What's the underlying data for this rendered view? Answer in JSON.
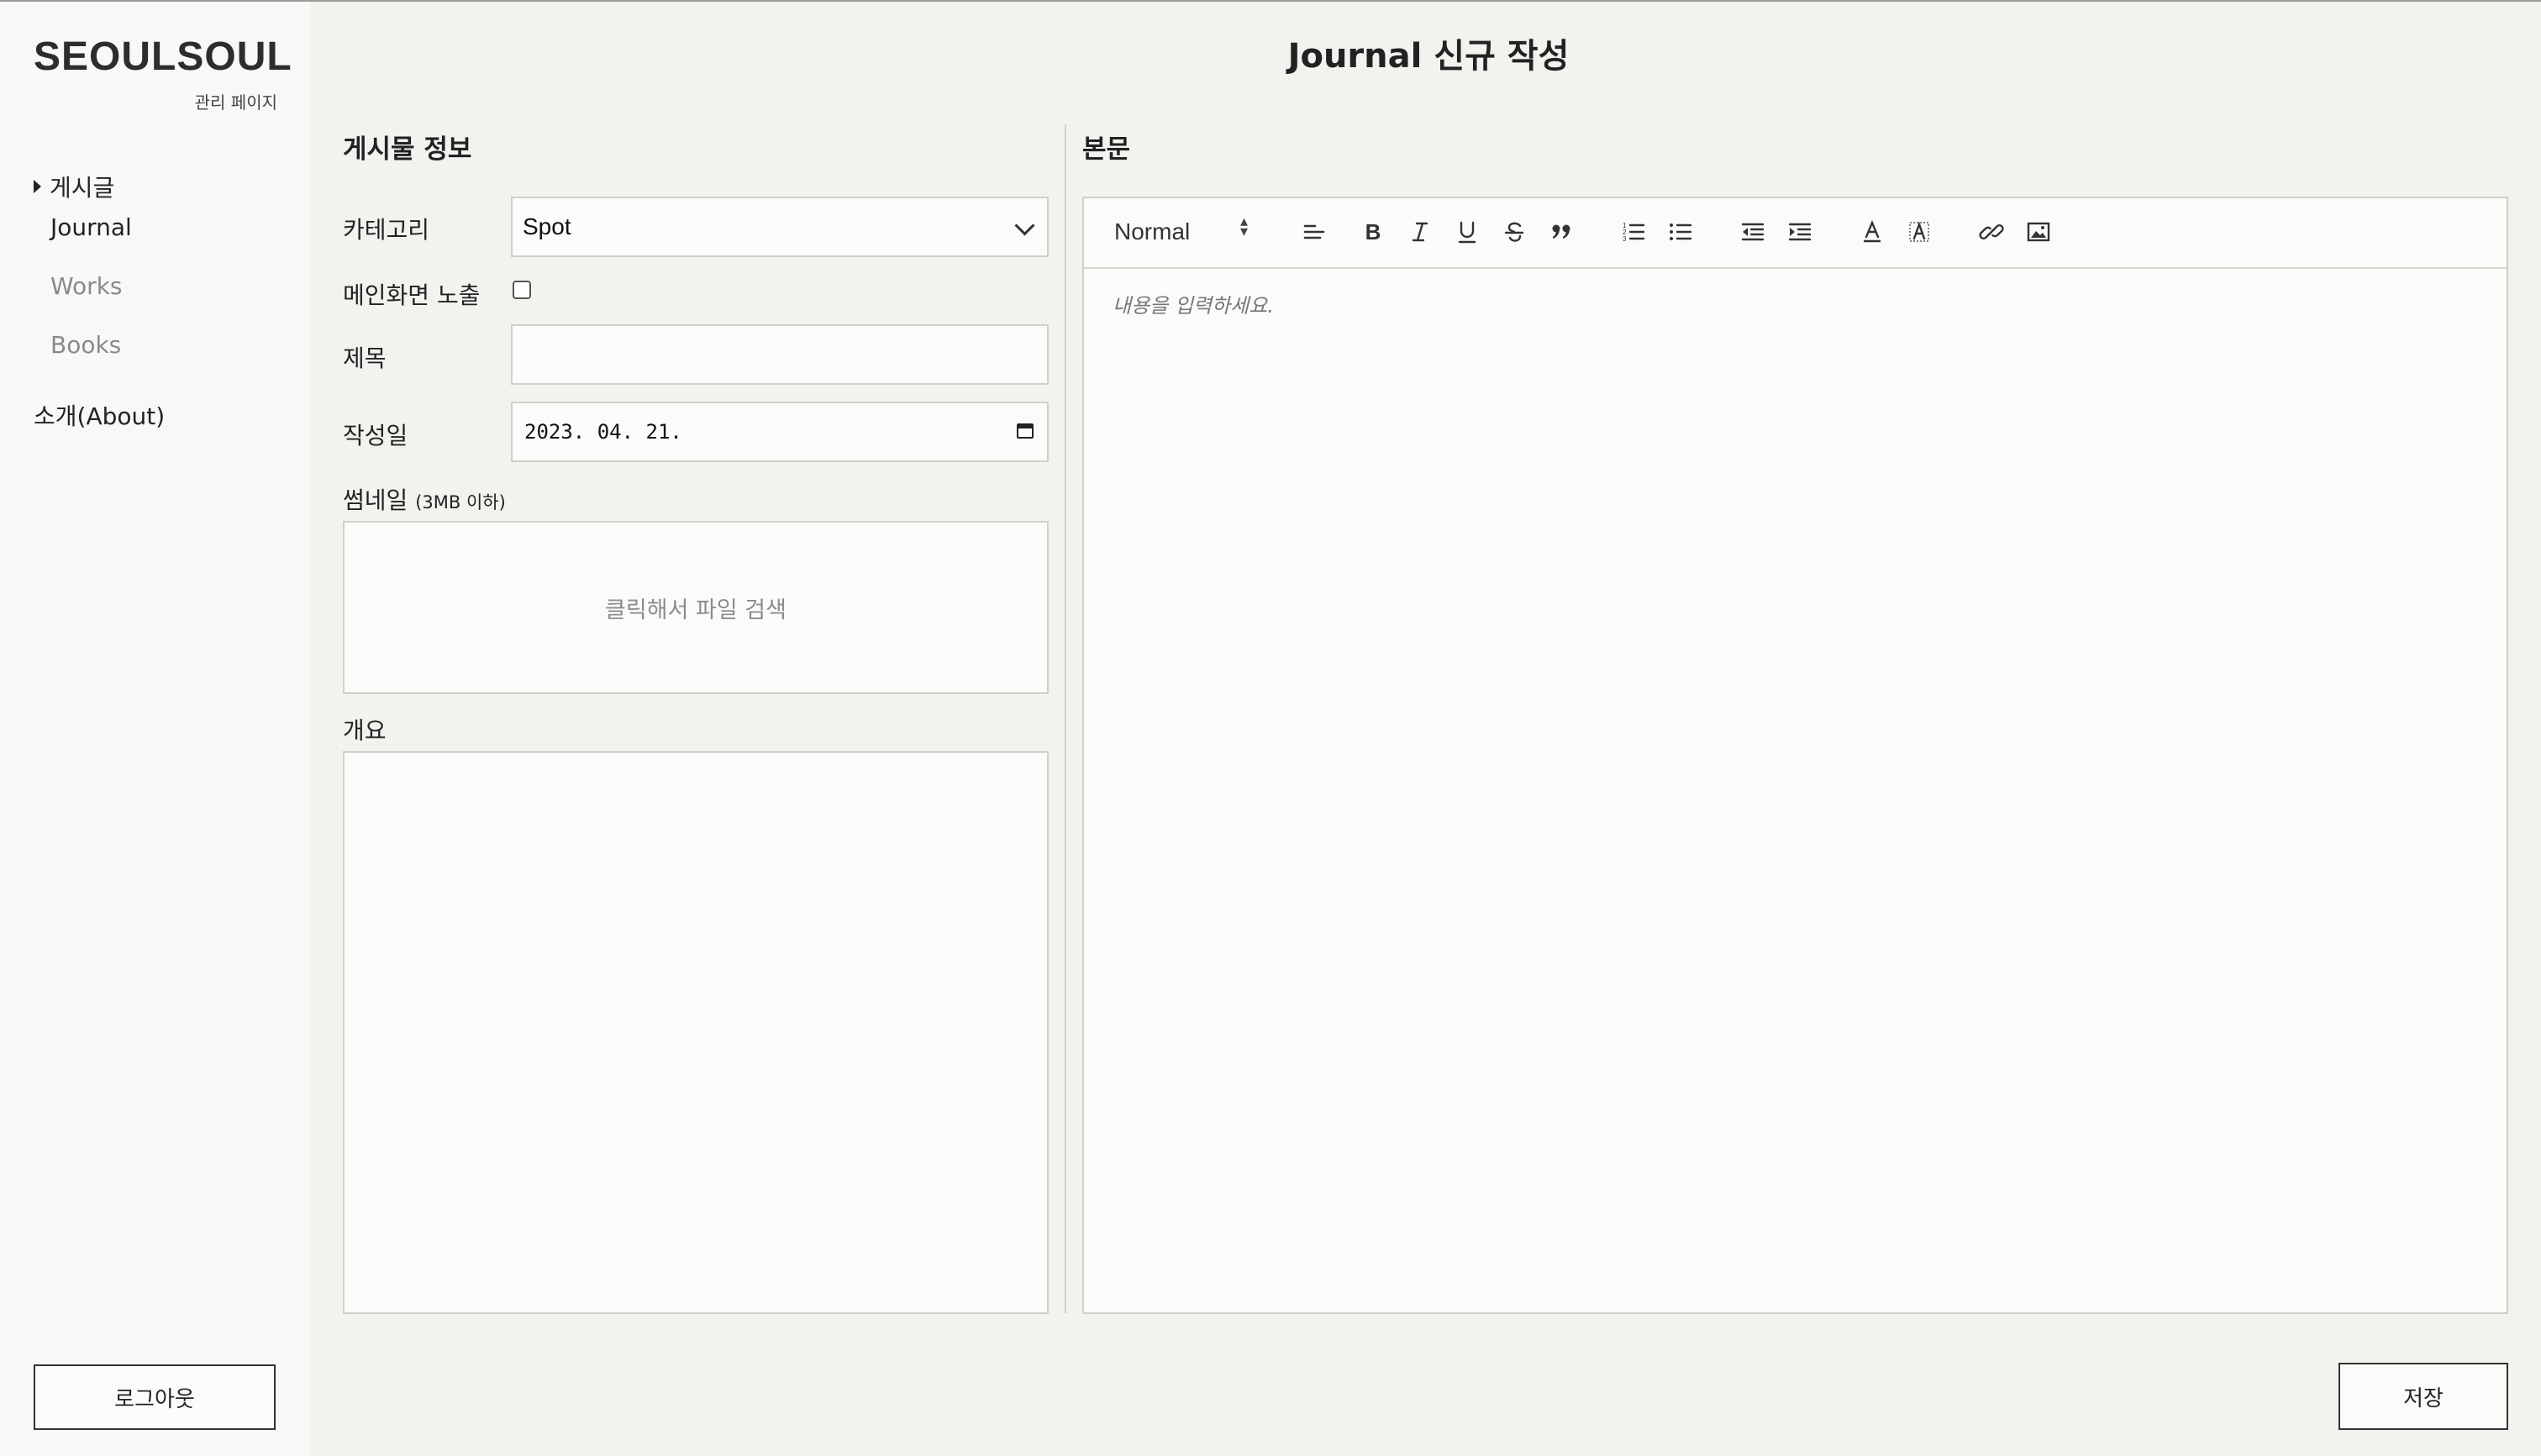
{
  "brand": {
    "name": "SEOULSOUL",
    "subtitle": "관리 페이지"
  },
  "sidebar": {
    "group_label": "게시글",
    "items": [
      {
        "label": "Journal",
        "active": true
      },
      {
        "label": "Works",
        "active": false
      },
      {
        "label": "Books",
        "active": false
      }
    ],
    "about_label": "소개(About)",
    "logout_label": "로그아웃"
  },
  "page": {
    "title": "Journal 신규 작성"
  },
  "post_info": {
    "heading": "게시물 정보",
    "category_label": "카테고리",
    "category_value": "Spot",
    "main_display_label": "메인화면 노출",
    "main_display_checked": false,
    "title_label": "제목",
    "title_value": "",
    "date_label": "작성일",
    "date_value": "2023. 04. 21.",
    "thumbnail_label": "썸네일",
    "thumbnail_note": "(3MB 이하)",
    "thumbnail_placeholder": "클릭해서 파일 검색",
    "summary_label": "개요",
    "summary_value": ""
  },
  "body": {
    "heading": "본문",
    "format_select": "Normal",
    "placeholder": "내용을 입력하세요.",
    "toolbar_icons": [
      "align-left-icon",
      "bold-icon",
      "italic-icon",
      "underline-icon",
      "strike-icon",
      "blockquote-icon",
      "ordered-list-icon",
      "bullet-list-icon",
      "outdent-icon",
      "indent-icon",
      "text-color-icon",
      "background-color-icon",
      "link-icon",
      "image-icon"
    ]
  },
  "actions": {
    "save_label": "저장"
  },
  "colors": {
    "background": "#f3f2ef",
    "sidebar": "#f8f8f6",
    "border": "#cfcfcc",
    "placeholder": "#8c8c8c"
  }
}
